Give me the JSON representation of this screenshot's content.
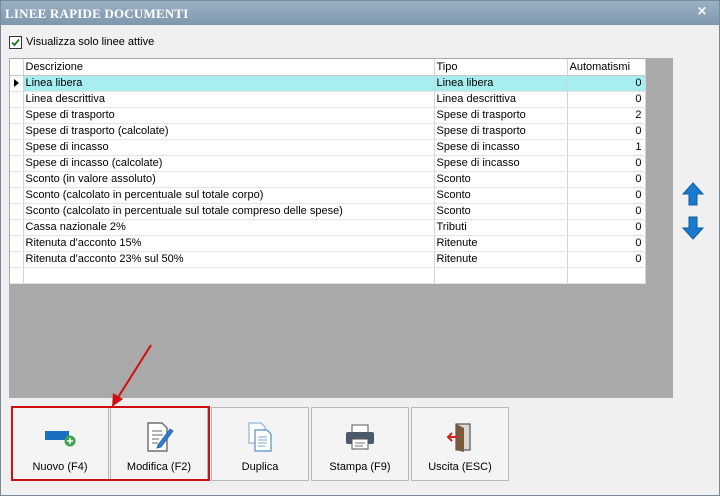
{
  "window": {
    "title": "LINEE RAPIDE DOCUMENTI",
    "close_glyph": "×"
  },
  "filter": {
    "label": "Visualizza solo linee attive",
    "checked": true
  },
  "grid": {
    "headers": {
      "descrizione": "Descrizione",
      "tipo": "Tipo",
      "automatismi": "Automatismi"
    },
    "rows": [
      {
        "descrizione": "Linea libera",
        "tipo": "Linea libera",
        "automatismi": "0"
      },
      {
        "descrizione": "Linea descrittiva",
        "tipo": "Linea descrittiva",
        "automatismi": "0"
      },
      {
        "descrizione": "Spese di trasporto",
        "tipo": "Spese di trasporto",
        "automatismi": "2"
      },
      {
        "descrizione": "Spese di trasporto (calcolate)",
        "tipo": "Spese di trasporto",
        "automatismi": "0"
      },
      {
        "descrizione": "Spese di incasso",
        "tipo": "Spese di incasso",
        "automatismi": "1"
      },
      {
        "descrizione": "Spese di incasso (calcolate)",
        "tipo": "Spese di incasso",
        "automatismi": "0"
      },
      {
        "descrizione": "Sconto (in valore assoluto)",
        "tipo": "Sconto",
        "automatismi": "0"
      },
      {
        "descrizione": "Sconto (calcolato in percentuale sul totale corpo)",
        "tipo": "Sconto",
        "automatismi": "0"
      },
      {
        "descrizione": "Sconto (calcolato in percentuale sul totale compreso delle spese)",
        "tipo": "Sconto",
        "automatismi": "0"
      },
      {
        "descrizione": "Cassa nazionale 2%",
        "tipo": "Tributi",
        "automatismi": "0"
      },
      {
        "descrizione": "Ritenuta d'acconto 15%",
        "tipo": "Ritenute",
        "automatismi": "0"
      },
      {
        "descrizione": "Ritenuta d'acconto 23% sul 50%",
        "tipo": "Ritenute",
        "automatismi": "0"
      }
    ],
    "selected_row": 0
  },
  "side_buttons": {
    "up_icon": "arrow-up-icon",
    "down_icon": "arrow-down-icon"
  },
  "toolbar": {
    "nuovo": "Nuovo (F4)",
    "modifica": "Modifica (F2)",
    "duplica": "Duplica",
    "stampa": "Stampa (F9)",
    "uscita": "Uscita (ESC)"
  },
  "colors": {
    "selection": "#a6eef0",
    "accent_arrow": "#1a7ad0",
    "annotation": "#d01010"
  }
}
